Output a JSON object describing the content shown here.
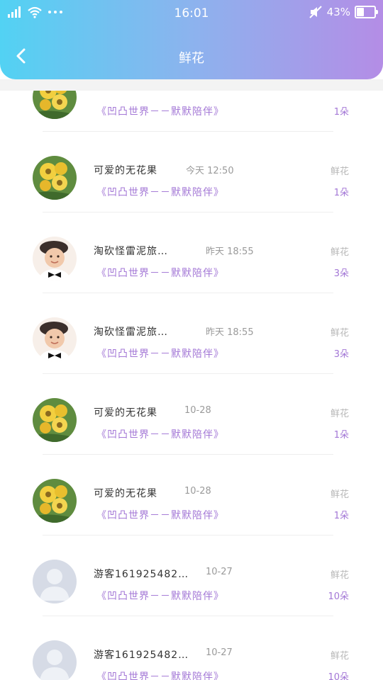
{
  "status_bar": {
    "time": "16:01",
    "battery": "43%",
    "battery_fraction": 0.43,
    "icons": [
      "signal-icon",
      "wifi-icon",
      "more-dots-icon",
      "mute-icon",
      "battery-icon"
    ]
  },
  "header": {
    "title": "鲜花",
    "back_icon": "back-arrow-icon",
    "gradient": [
      "#52d2f3",
      "#b48de6"
    ]
  },
  "colors": {
    "gift_text": "#a377d6",
    "name_text": "#333333",
    "muted_text": "#9a9a9a"
  },
  "records": [
    {
      "avatar": "flower",
      "name": "",
      "date": "",
      "gift": "《凹凸世界－－默默陪伴》",
      "type": "",
      "count": "1朵"
    },
    {
      "avatar": "flower",
      "name": "可爱的无花果",
      "date": "今天 12:50",
      "gift": "《凹凸世界－－默默陪伴》",
      "type": "鲜花",
      "count": "1朵"
    },
    {
      "avatar": "kid",
      "name": "淘砍怪雷泥旅…",
      "date": "昨天 18:55",
      "gift": "《凹凸世界－－默默陪伴》",
      "type": "鲜花",
      "count": "3朵"
    },
    {
      "avatar": "kid",
      "name": "淘砍怪雷泥旅…",
      "date": "昨天 18:55",
      "gift": "《凹凸世界－－默默陪伴》",
      "type": "鲜花",
      "count": "3朵"
    },
    {
      "avatar": "flower",
      "name": "可爱的无花果",
      "date": "10-28",
      "gift": "《凹凸世界－－默默陪伴》",
      "type": "鲜花",
      "count": "1朵"
    },
    {
      "avatar": "flower",
      "name": "可爱的无花果",
      "date": "10-28",
      "gift": "《凹凸世界－－默默陪伴》",
      "type": "鲜花",
      "count": "1朵"
    },
    {
      "avatar": "guest",
      "name": "游客161925482…",
      "date": "10-27",
      "gift": "《凹凸世界－－默默陪伴》",
      "type": "鲜花",
      "count": "10朵"
    },
    {
      "avatar": "guest",
      "name": "游客161925482…",
      "date": "10-27",
      "gift": "《凹凸世界－－默默陪伴》",
      "type": "鲜花",
      "count": "10朵"
    }
  ]
}
